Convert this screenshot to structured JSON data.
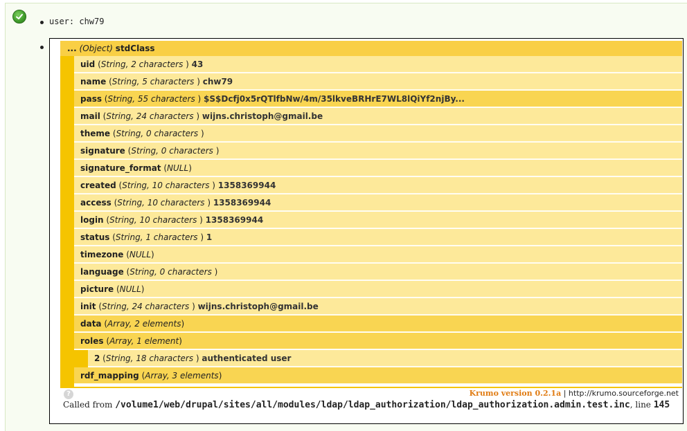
{
  "user_line": "user: chw79",
  "root": {
    "ellipsis": "...",
    "type": "(Object)",
    "class": "stdClass"
  },
  "rows": [
    {
      "name": "uid",
      "type": "String, 2 characters ",
      "value": "43",
      "shade": "light"
    },
    {
      "name": "name",
      "type": "String, 5 characters ",
      "value": "chw79",
      "shade": "light"
    },
    {
      "name": "pass",
      "type": "String, 55 characters ",
      "value": "$S$Dcfj0x5rQTlfbNw/4m/35lkveBRHrE7WL8lQiYf2njBy...",
      "shade": "dark"
    },
    {
      "name": "mail",
      "type": "String, 24 characters ",
      "value": "wijns.christoph@gmail.be",
      "shade": "light"
    },
    {
      "name": "theme",
      "type": "String, 0 characters ",
      "value": "",
      "shade": "light"
    },
    {
      "name": "signature",
      "type": "String, 0 characters ",
      "value": "",
      "shade": "light"
    },
    {
      "name": "signature_format",
      "type": "NULL",
      "value": "",
      "shade": "light"
    },
    {
      "name": "created",
      "type": "String, 10 characters ",
      "value": "1358369944",
      "shade": "light"
    },
    {
      "name": "access",
      "type": "String, 10 characters ",
      "value": "1358369944",
      "shade": "light"
    },
    {
      "name": "login",
      "type": "String, 10 characters ",
      "value": "1358369944",
      "shade": "light"
    },
    {
      "name": "status",
      "type": "String, 1 characters ",
      "value": "1",
      "shade": "light"
    },
    {
      "name": "timezone",
      "type": "NULL",
      "value": "",
      "shade": "light"
    },
    {
      "name": "language",
      "type": "String, 0 characters ",
      "value": "",
      "shade": "light"
    },
    {
      "name": "picture",
      "type": "NULL",
      "value": "",
      "shade": "light"
    },
    {
      "name": "init",
      "type": "String, 24 characters ",
      "value": "wijns.christoph@gmail.be",
      "shade": "light"
    },
    {
      "name": "data",
      "type": "Array, 2 elements",
      "value": "",
      "shade": "dark"
    },
    {
      "name": "roles",
      "type": "Array, 1 element",
      "value": "",
      "shade": "dark"
    },
    {
      "name": "2",
      "type": "String, 18 characters ",
      "value": "authenticated user",
      "shade": "light",
      "nested": true
    },
    {
      "name": "rdf_mapping",
      "type": "Array, 3 elements",
      "value": "",
      "shade": "dark"
    }
  ],
  "footer": {
    "help": "?",
    "brand": "Krumo version 0.2.1a",
    "separator": " | ",
    "url": "http://krumo.sourceforge.net",
    "called_from": "Called from ",
    "path": "/volume1/web/drupal/sites/all/modules/ldap/ldap_authorization/ldap_authorization.admin.test.inc",
    "line_label": ", line ",
    "line_number": "145"
  }
}
